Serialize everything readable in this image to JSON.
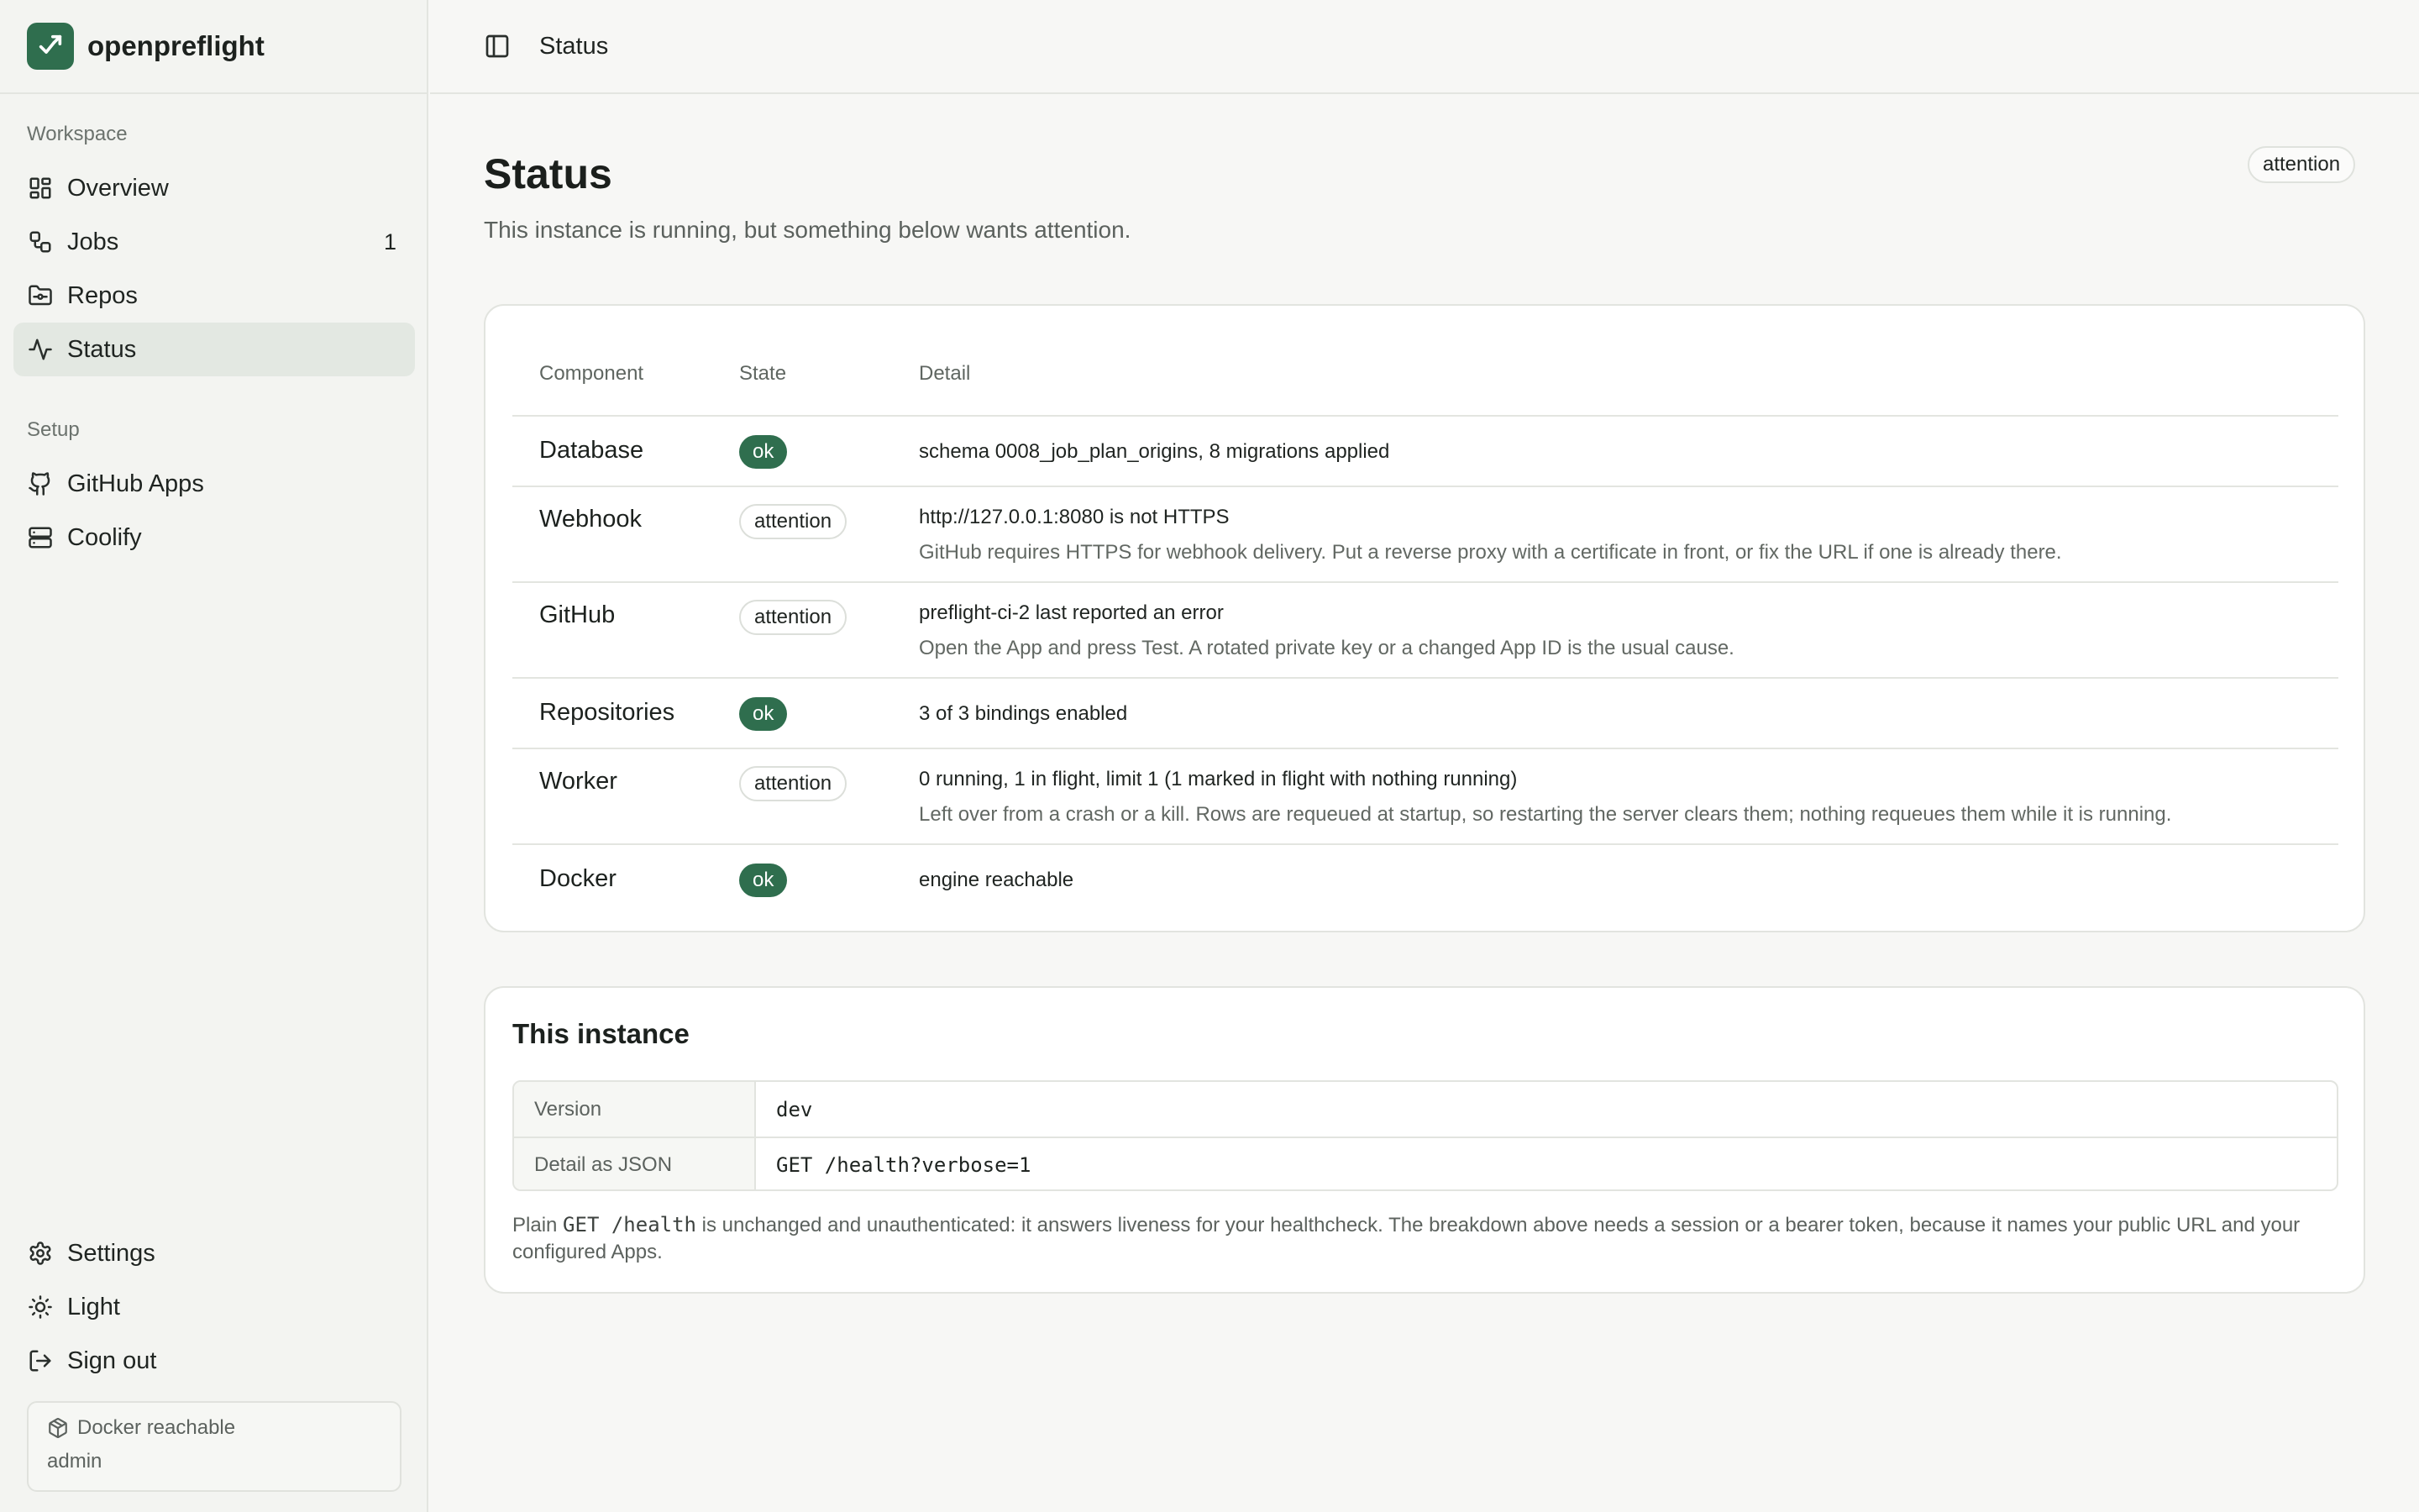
{
  "brand": {
    "name": "openpreflight",
    "color": "#2f6e4e"
  },
  "sidebar": {
    "workspace_label": "Workspace",
    "workspace_items": [
      {
        "label": "Overview",
        "icon": "grid-icon"
      },
      {
        "label": "Jobs",
        "icon": "workflow-icon",
        "count": "1"
      },
      {
        "label": "Repos",
        "icon": "folder-git-icon"
      },
      {
        "label": "Status",
        "icon": "activity-icon",
        "active": true
      }
    ],
    "setup_label": "Setup",
    "setup_items": [
      {
        "label": "GitHub Apps",
        "icon": "github-icon"
      },
      {
        "label": "Coolify",
        "icon": "server-icon"
      }
    ],
    "bottom_items": [
      {
        "label": "Settings",
        "icon": "gear-icon"
      },
      {
        "label": "Light",
        "icon": "sun-icon"
      },
      {
        "label": "Sign out",
        "icon": "sign-out-icon"
      }
    ],
    "footer": {
      "docker_status": "Docker reachable",
      "user": "admin"
    }
  },
  "topbar": {
    "title": "Status"
  },
  "page": {
    "title": "Status",
    "subtitle": "This instance is running, but something below wants attention.",
    "badge": "attention"
  },
  "status_table": {
    "headers": {
      "component": "Component",
      "state": "State",
      "detail": "Detail"
    },
    "rows": [
      {
        "component": "Database",
        "state": "ok",
        "detail": "schema 0008_job_plan_origins, 8 migrations applied",
        "sub": ""
      },
      {
        "component": "Webhook",
        "state": "attention",
        "detail": "http://127.0.0.1:8080 is not HTTPS",
        "sub": "GitHub requires HTTPS for webhook delivery. Put a reverse proxy with a certificate in front, or fix the URL if one is already there."
      },
      {
        "component": "GitHub",
        "state": "attention",
        "detail": "preflight-ci-2 last reported an error",
        "sub": "Open the App and press Test. A rotated private key or a changed App ID is the usual cause."
      },
      {
        "component": "Repositories",
        "state": "ok",
        "detail": "3 of 3 bindings enabled",
        "sub": ""
      },
      {
        "component": "Worker",
        "state": "attention",
        "detail": "0 running, 1 in flight, limit 1 (1 marked in flight with nothing running)",
        "sub": "Left over from a crash or a kill. Rows are requeued at startup, so restarting the server clears them; nothing requeues them while it is running."
      },
      {
        "component": "Docker",
        "state": "ok",
        "detail": "engine reachable",
        "sub": ""
      }
    ]
  },
  "instance": {
    "title": "This instance",
    "version_label": "Version",
    "version_value": "dev",
    "json_label": "Detail as JSON",
    "json_value": "GET /health?verbose=1",
    "note_prefix": "Plain ",
    "note_code": "GET /health",
    "note_suffix": " is unchanged and unauthenticated: it answers liveness for your healthcheck. The breakdown above needs a session or a bearer token, because it names your public URL and your configured Apps."
  }
}
